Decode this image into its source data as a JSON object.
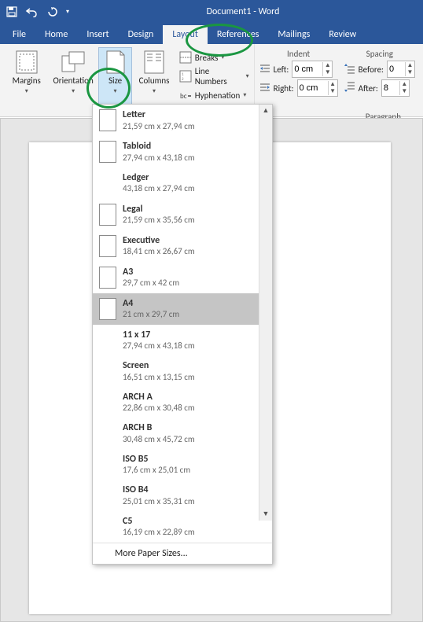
{
  "titlebar": {
    "title": "Document1 - Word"
  },
  "tabs": {
    "file": "File",
    "home": "Home",
    "insert": "Insert",
    "design": "Design",
    "layout": "Layout",
    "references": "References",
    "mailings": "Mailings",
    "review": "Review"
  },
  "page_setup": {
    "margins": "Margins",
    "orientation": "Orientation",
    "size": "Size",
    "columns": "Columns",
    "breaks": "Breaks",
    "line_numbers": "Line Numbers",
    "hyphenation": "Hyphenation"
  },
  "indent": {
    "header": "Indent",
    "left_label": "Left:",
    "right_label": "Right:",
    "left_value": "0 cm",
    "right_value": "0 cm"
  },
  "spacing": {
    "header": "Spacing",
    "before_label": "Before:",
    "after_label": "After:",
    "before_value": "0",
    "after_value": "8"
  },
  "paragraph_group": "Paragraph",
  "size_menu": {
    "items": [
      {
        "name": "Letter",
        "dim": "21,59 cm x 27,94 cm",
        "icon": true,
        "selected": false
      },
      {
        "name": "Tabloid",
        "dim": "27,94 cm x 43,18 cm",
        "icon": true,
        "selected": false
      },
      {
        "name": "Ledger",
        "dim": "43,18 cm x 27,94 cm",
        "icon": false,
        "selected": false
      },
      {
        "name": "Legal",
        "dim": "21,59 cm x 35,56 cm",
        "icon": true,
        "selected": false
      },
      {
        "name": "Executive",
        "dim": "18,41 cm x 26,67 cm",
        "icon": true,
        "selected": false
      },
      {
        "name": "A3",
        "dim": "29,7 cm x 42 cm",
        "icon": true,
        "selected": false
      },
      {
        "name": "A4",
        "dim": "21 cm x 29,7 cm",
        "icon": true,
        "selected": true
      },
      {
        "name": "11 x 17",
        "dim": "27,94 cm x 43,18 cm",
        "icon": false,
        "selected": false
      },
      {
        "name": "Screen",
        "dim": "16,51 cm x 13,15 cm",
        "icon": false,
        "selected": false
      },
      {
        "name": "ARCH A",
        "dim": "22,86 cm x 30,48 cm",
        "icon": false,
        "selected": false
      },
      {
        "name": "ARCH B",
        "dim": "30,48 cm x 45,72 cm",
        "icon": false,
        "selected": false
      },
      {
        "name": "ISO B5",
        "dim": "17,6 cm x 25,01 cm",
        "icon": false,
        "selected": false
      },
      {
        "name": "ISO B4",
        "dim": "25,01 cm x 35,31 cm",
        "icon": false,
        "selected": false
      },
      {
        "name": "C5",
        "dim": "16,19 cm x 22,89 cm",
        "icon": false,
        "selected": false
      }
    ],
    "more": "More Paper Sizes..."
  }
}
